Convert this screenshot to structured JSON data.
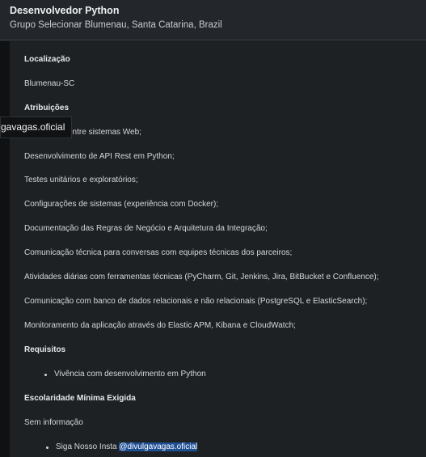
{
  "header": {
    "title": "Desenvolvedor Python",
    "company_location": "Grupo Selecionar Blumenau, Santa Catarina, Brazil"
  },
  "tooltip": {
    "text": "gavagas.oficial"
  },
  "description": {
    "location_heading": "Localização",
    "location_value": "Blumenau-SC",
    "duties_heading": "Atribuições",
    "duties": [
      "Integração entre sistemas Web;",
      "Desenvolvimento de API Rest em Python;",
      "Testes unitários e exploratórios;",
      "Configurações de sistemas (experiência com Docker);",
      "Documentação das Regras de Negócio e Arquitetura da Integração;",
      "Comunicação técnica para conversas com equipes técnicas dos parceiros;",
      "Atividades diárias com ferramentas técnicas (PyCharm, Git, Jenkins, Jira, BitBucket e Confluence);",
      "Comunicação com banco de dados relacionais e não relacionais (PostgreSQL e ElasticSearch);",
      "Monitoramento da aplicação através do Elastic APM, Kibana e CloudWatch;"
    ],
    "duty_partial_visible": "entre sistemas Web;",
    "requirements_heading": "Requisitos",
    "requirements": [
      "Vivência com desenvolvimento em Python"
    ],
    "education_heading": "Escolaridade Mínima Exigida",
    "education_value": "Sem informação",
    "follow_prefix": "Siga Nosso Insta ",
    "follow_handle": "@divulgavagas.oficial"
  }
}
